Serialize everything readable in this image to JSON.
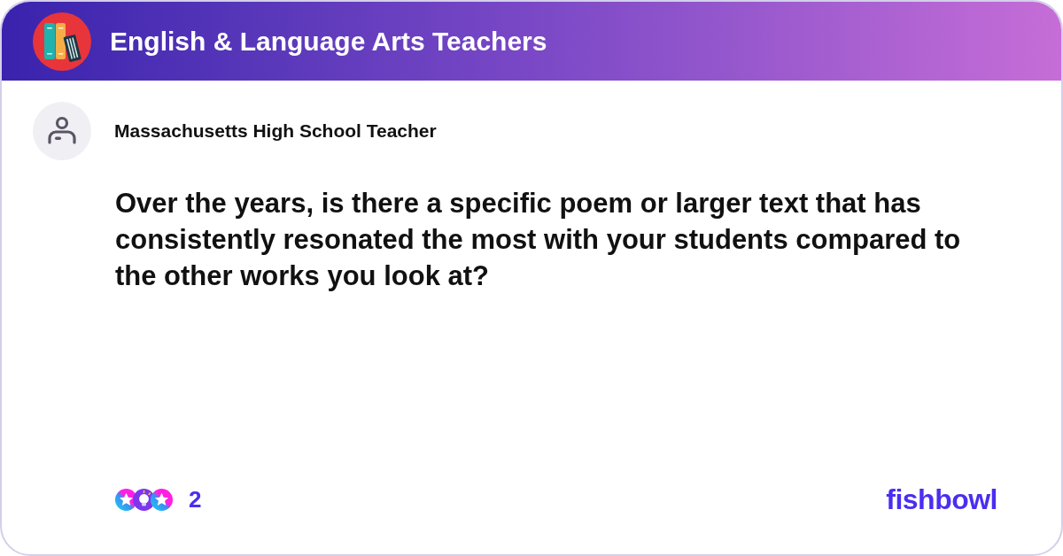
{
  "header": {
    "title": "English & Language Arts Teachers"
  },
  "post": {
    "author": "Massachusetts High School Teacher",
    "question": "Over the years, is there a specific poem or larger text that has consistently resonated the most with your students compared to the other works you look at?"
  },
  "footer": {
    "reaction_count": "2",
    "brand": "fishbowl"
  }
}
